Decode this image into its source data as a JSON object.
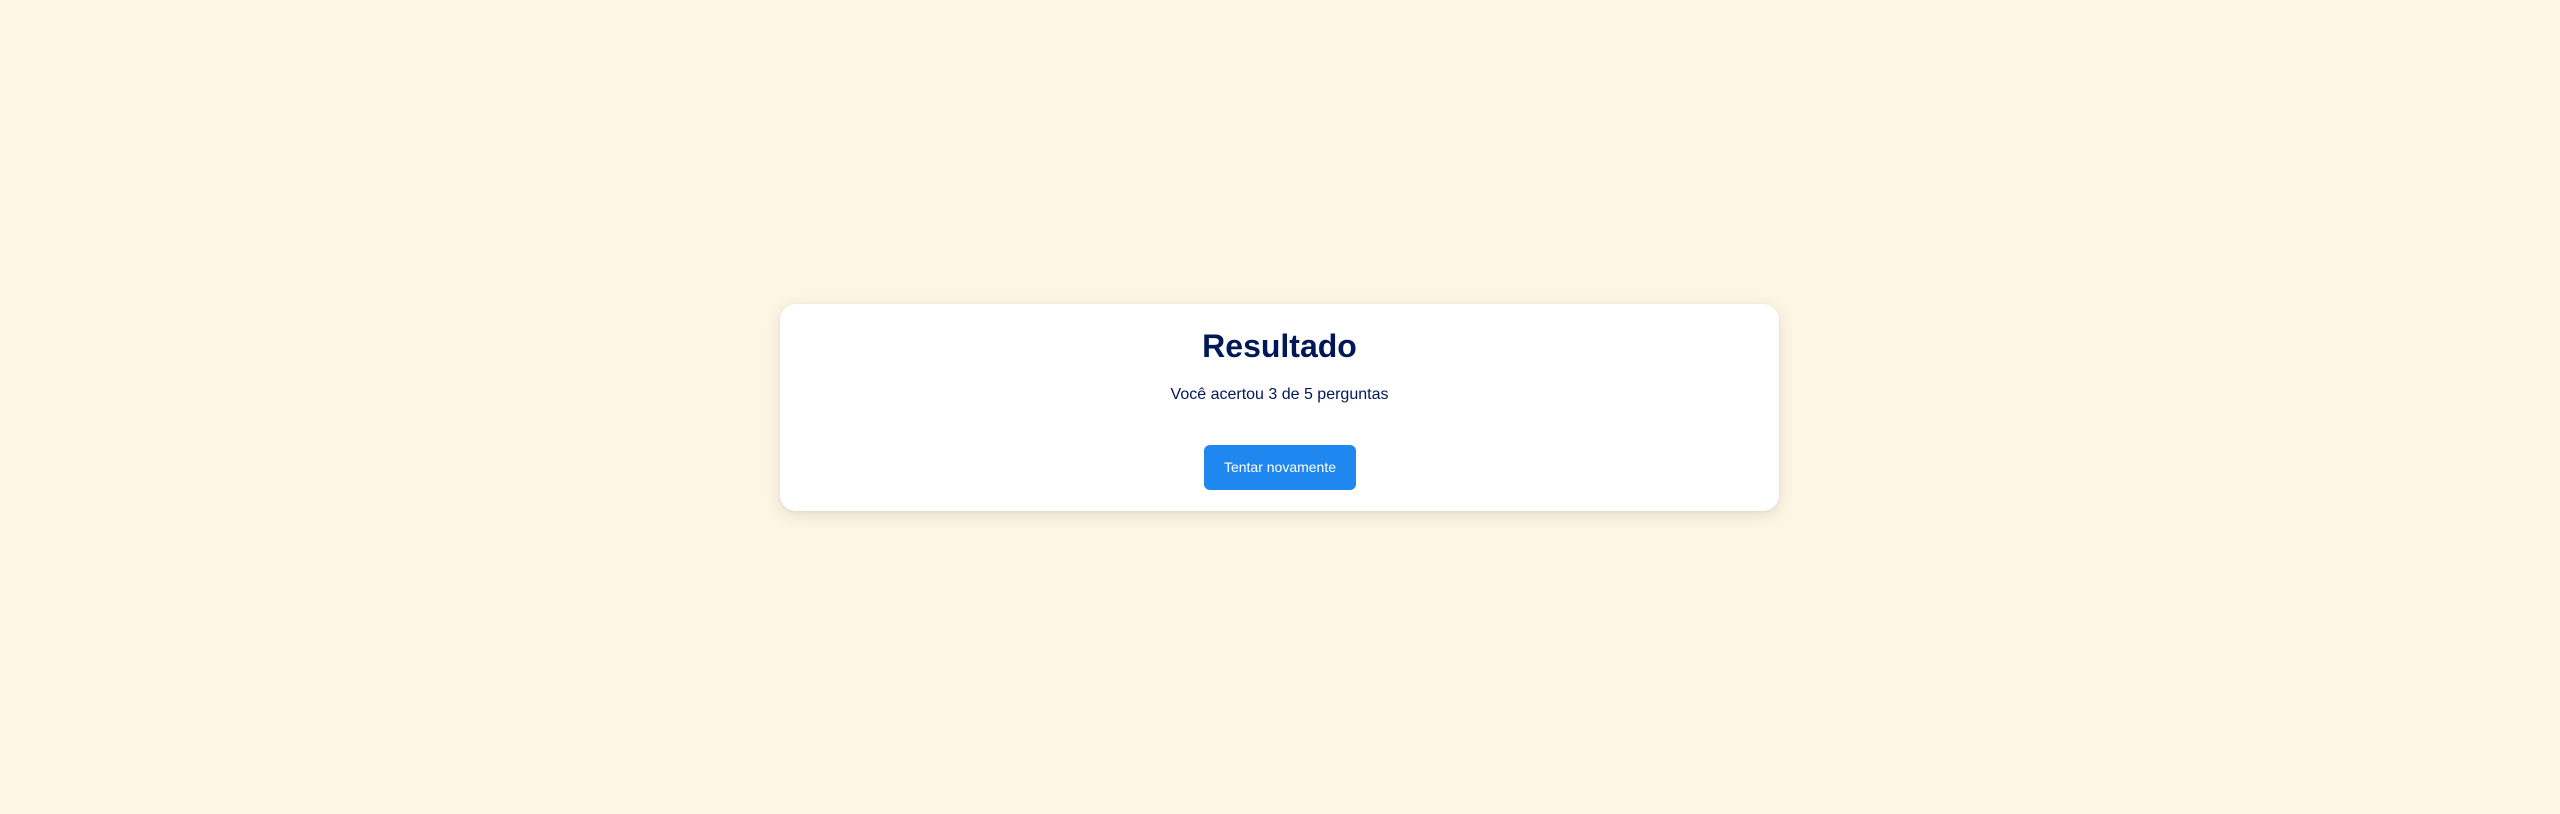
{
  "theme": {
    "background": "#fef6e4",
    "card_background": "#ffffff",
    "text_color": "#001858",
    "accent": "#1e88f0"
  },
  "result": {
    "title": "Resultado",
    "score_text": "Você acertou 3 de 5 perguntas",
    "correct": 3,
    "total": 5,
    "retry_label": "Tentar novamente"
  }
}
